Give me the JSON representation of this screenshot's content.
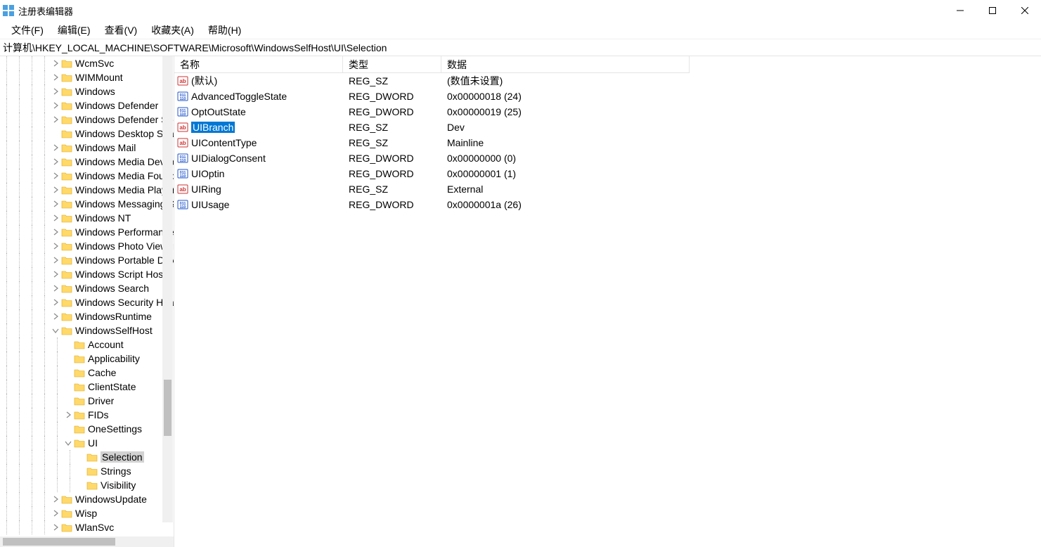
{
  "app": {
    "title": "注册表编辑器"
  },
  "menu": {
    "file": "文件(F)",
    "edit": "编辑(E)",
    "view": "查看(V)",
    "favorites": "收藏夹(A)",
    "help": "帮助(H)"
  },
  "address": "计算机\\HKEY_LOCAL_MACHINE\\SOFTWARE\\Microsoft\\WindowsSelfHost\\UI\\Selection",
  "columns": {
    "name": "名称",
    "type": "类型",
    "data": "数据"
  },
  "tree": [
    {
      "indent": 4,
      "exp": "closed",
      "label": "WcmSvc"
    },
    {
      "indent": 4,
      "exp": "closed",
      "label": "WIMMount"
    },
    {
      "indent": 4,
      "exp": "closed",
      "label": "Windows"
    },
    {
      "indent": 4,
      "exp": "closed",
      "label": "Windows Defender"
    },
    {
      "indent": 4,
      "exp": "closed",
      "label": "Windows Defender Security Center"
    },
    {
      "indent": 4,
      "exp": "none",
      "label": "Windows Desktop Search"
    },
    {
      "indent": 4,
      "exp": "closed",
      "label": "Windows Mail"
    },
    {
      "indent": 4,
      "exp": "closed",
      "label": "Windows Media Device Manager"
    },
    {
      "indent": 4,
      "exp": "closed",
      "label": "Windows Media Foundation"
    },
    {
      "indent": 4,
      "exp": "closed",
      "label": "Windows Media Player NSS"
    },
    {
      "indent": 4,
      "exp": "closed",
      "label": "Windows Messaging Subsystem"
    },
    {
      "indent": 4,
      "exp": "closed",
      "label": "Windows NT"
    },
    {
      "indent": 4,
      "exp": "closed",
      "label": "Windows Performance Toolkit"
    },
    {
      "indent": 4,
      "exp": "closed",
      "label": "Windows Photo Viewer"
    },
    {
      "indent": 4,
      "exp": "closed",
      "label": "Windows Portable Devices"
    },
    {
      "indent": 4,
      "exp": "closed",
      "label": "Windows Script Host"
    },
    {
      "indent": 4,
      "exp": "closed",
      "label": "Windows Search"
    },
    {
      "indent": 4,
      "exp": "closed",
      "label": "Windows Security Health"
    },
    {
      "indent": 4,
      "exp": "closed",
      "label": "WindowsRuntime"
    },
    {
      "indent": 4,
      "exp": "open",
      "label": "WindowsSelfHost"
    },
    {
      "indent": 5,
      "exp": "none",
      "label": "Account"
    },
    {
      "indent": 5,
      "exp": "none",
      "label": "Applicability"
    },
    {
      "indent": 5,
      "exp": "none",
      "label": "Cache"
    },
    {
      "indent": 5,
      "exp": "none",
      "label": "ClientState"
    },
    {
      "indent": 5,
      "exp": "none",
      "label": "Driver"
    },
    {
      "indent": 5,
      "exp": "closed",
      "label": "FIDs"
    },
    {
      "indent": 5,
      "exp": "none",
      "label": "OneSettings"
    },
    {
      "indent": 5,
      "exp": "open",
      "label": "UI"
    },
    {
      "indent": 6,
      "exp": "none",
      "label": "Selection",
      "selected": true
    },
    {
      "indent": 6,
      "exp": "none",
      "label": "Strings"
    },
    {
      "indent": 6,
      "exp": "none",
      "label": "Visibility"
    },
    {
      "indent": 4,
      "exp": "closed",
      "label": "WindowsUpdate"
    },
    {
      "indent": 4,
      "exp": "closed",
      "label": "Wisp"
    },
    {
      "indent": 4,
      "exp": "closed",
      "label": "WlanSvc"
    }
  ],
  "values": [
    {
      "icon": "sz",
      "name": "(默认)",
      "type": "REG_SZ",
      "data": "(数值未设置)"
    },
    {
      "icon": "dword",
      "name": "AdvancedToggleState",
      "type": "REG_DWORD",
      "data": "0x00000018 (24)"
    },
    {
      "icon": "dword",
      "name": "OptOutState",
      "type": "REG_DWORD",
      "data": "0x00000019 (25)"
    },
    {
      "icon": "sz",
      "name": "UIBranch",
      "type": "REG_SZ",
      "data": "Dev",
      "selected": true
    },
    {
      "icon": "sz",
      "name": "UIContentType",
      "type": "REG_SZ",
      "data": "Mainline"
    },
    {
      "icon": "dword",
      "name": "UIDialogConsent",
      "type": "REG_DWORD",
      "data": "0x00000000 (0)"
    },
    {
      "icon": "dword",
      "name": "UIOptin",
      "type": "REG_DWORD",
      "data": "0x00000001 (1)"
    },
    {
      "icon": "sz",
      "name": "UIRing",
      "type": "REG_SZ",
      "data": "External"
    },
    {
      "icon": "dword",
      "name": "UIUsage",
      "type": "REG_DWORD",
      "data": "0x0000001a (26)"
    }
  ]
}
